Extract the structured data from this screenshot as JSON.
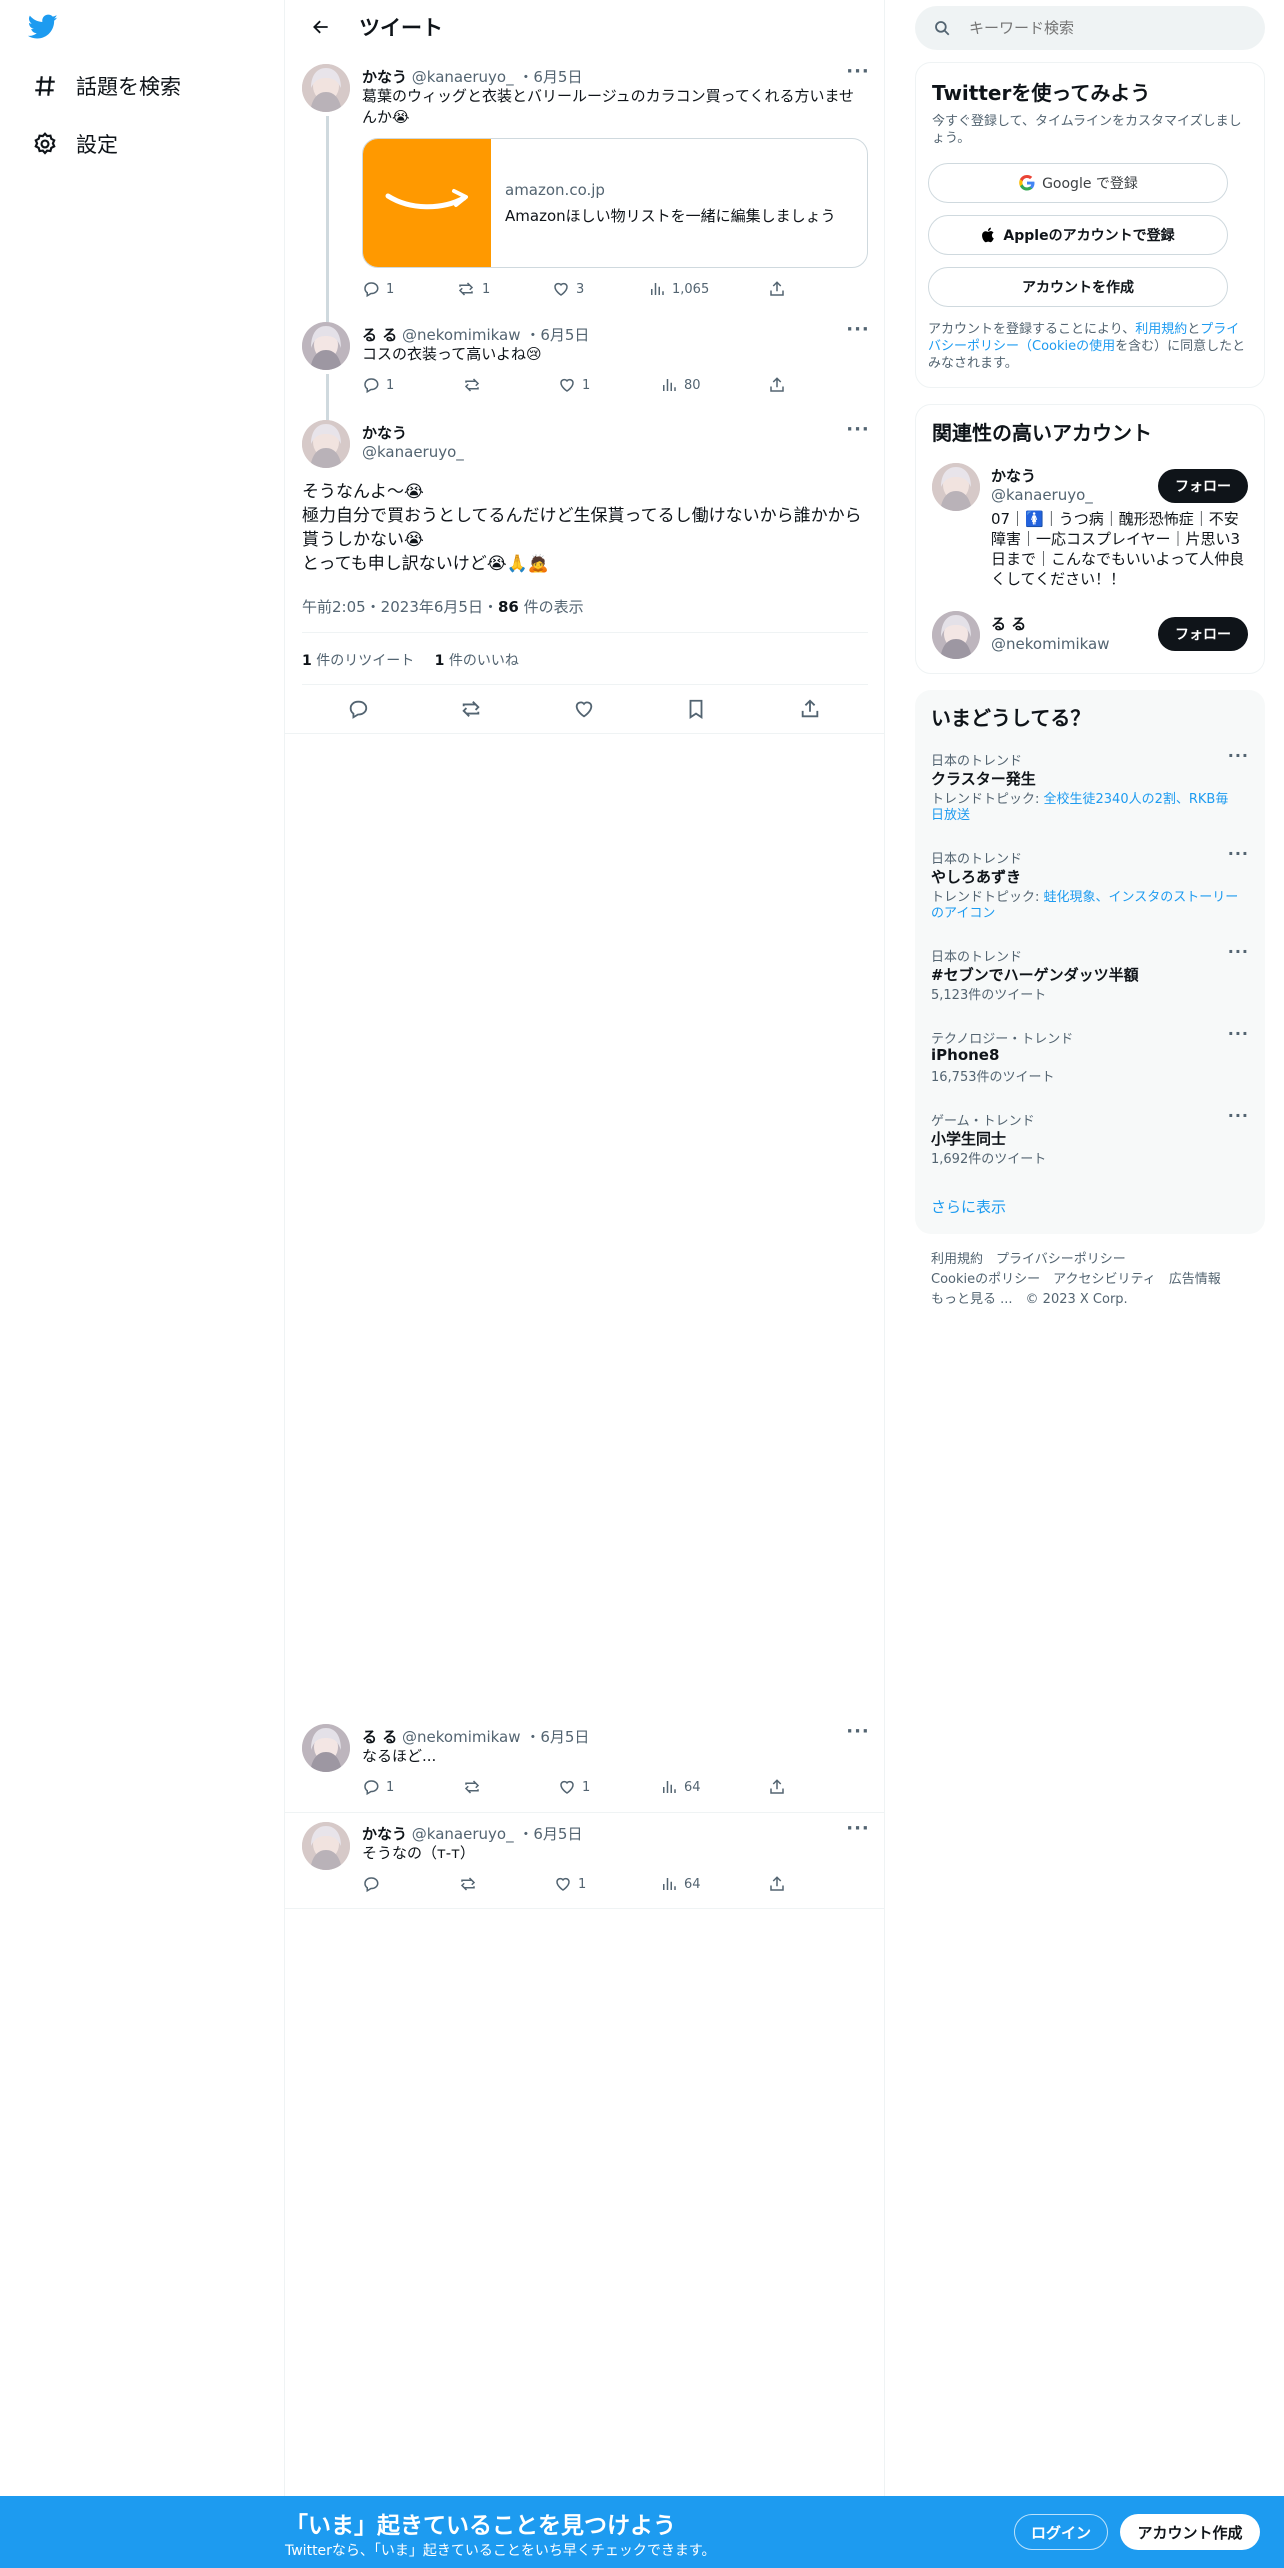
{
  "nav": {
    "explore_label": "話題を検索",
    "settings_label": "設定"
  },
  "header": {
    "title": "ツイート"
  },
  "tweets": [
    {
      "name": "かなう",
      "handle": "@kanaeruyo_",
      "date": "・6月5日",
      "text": "葛葉のウィッグと衣装とバリールージュのカラコン買ってくれる方いませんか😭",
      "card": {
        "domain": "amazon.co.jp",
        "title": "Amazonほしい物リストを一緒に編集しましょう"
      },
      "replies": "1",
      "retweets": "1",
      "likes": "3",
      "views": "1,065"
    },
    {
      "name": "る る",
      "handle": "@nekomimikaw",
      "date": "・6月5日",
      "text": "コスの衣装って高いよね😢",
      "replies": "1",
      "retweets": "",
      "likes": "1",
      "views": "80"
    }
  ],
  "focus": {
    "name": "かなう",
    "handle": "@kanaeruyo_",
    "line1": "そうなんよ〜😭",
    "line2": "極力自分で買おうとしてるんだけど生保貰ってるし働けないから誰かから貰うしかない😭",
    "line3": "とっても申し訳ないけど😭🙏🙇",
    "time": "午前2:05・2023年6月5日・",
    "views_count": "86",
    "views_label": " 件の表示",
    "retweets_count": "1",
    "retweets_label": " 件のリツイート",
    "likes_count": "1",
    "likes_label": " 件のいいね"
  },
  "replies": [
    {
      "name": "る る",
      "handle": "@nekomimikaw",
      "date": "・6月5日",
      "text": "なるほど...",
      "replies": "1",
      "retweets": "",
      "likes": "1",
      "views": "64"
    },
    {
      "name": "かなう",
      "handle": "@kanaeruyo_",
      "date": "・6月5日",
      "text": "そうなの（т-т）",
      "replies": "",
      "retweets": "",
      "likes": "1",
      "views": "64"
    }
  ],
  "search": {
    "placeholder": "キーワード検索"
  },
  "signup": {
    "title": "Twitterを使ってみよう",
    "sub": "今すぐ登録して、タイムラインをカスタマイズしましょう。",
    "google": "Google で登録",
    "apple": "Appleのアカウントで登録",
    "create": "アカウントを作成",
    "terms_a": "アカウントを登録することにより、",
    "terms_b": "利用規約",
    "terms_c": "と",
    "terms_d": "プライバシーポリシー（Cookieの使用",
    "terms_e": "を含む）に同意したとみなされます。"
  },
  "who": {
    "title": "関連性の高いアカウント",
    "accounts": [
      {
        "name": "かなう",
        "handle": "@kanaeruyo_",
        "bio": "07｜🚺｜うつ病｜醜形恐怖症｜不安障害｜一応コスプレイヤー｜片思い3日まで｜こんなでもいいよって人仲良くしてください！！",
        "button": "フォロー"
      },
      {
        "name": "る る",
        "handle": "@nekomimikaw",
        "button": "フォロー"
      }
    ]
  },
  "trends": {
    "title": "いまどうしてる？",
    "items": [
      {
        "meta": "日本のトレンド",
        "name": "クラスター発生",
        "sub_prefix": "トレンドトピック: ",
        "sub_link": "全校生徒2340人の2割、RKB毎日放送"
      },
      {
        "meta": "日本のトレンド",
        "name": "やしろあずき",
        "sub_prefix": "トレンドトピック: ",
        "sub_link": "蛙化現象、インスタのストーリーのアイコン"
      },
      {
        "meta": "日本のトレンド",
        "name": "#セブンでハーゲンダッツ半額",
        "sub_plain": "5,123件のツイート"
      },
      {
        "meta": "テクノロジー・トレンド",
        "name": "iPhone8",
        "sub_plain": "16,753件のツイート"
      },
      {
        "meta": "ゲーム・トレンド",
        "name": "小学生同士",
        "sub_plain": "1,692件のツイート"
      }
    ],
    "show_more": "さらに表示"
  },
  "footer": {
    "l1": "利用規約",
    "l2": "プライバシーポリシー",
    "l3": "Cookieのポリシー",
    "l4": "アクセシビリティ",
    "l5": "広告情報",
    "l6": "もっと見る ...",
    "l7": "© 2023 X Corp."
  },
  "bottom": {
    "title": "「いま」起きていることを見つけよう",
    "sub": "Twitterなら、「いま」起きていることをいち早くチェックできます。",
    "login": "ログイン",
    "signup": "アカウント作成"
  },
  "colors": {
    "accent": "#1d9bf0",
    "text": "#0f1419",
    "muted": "#536471",
    "amazon": "#ff9900"
  }
}
